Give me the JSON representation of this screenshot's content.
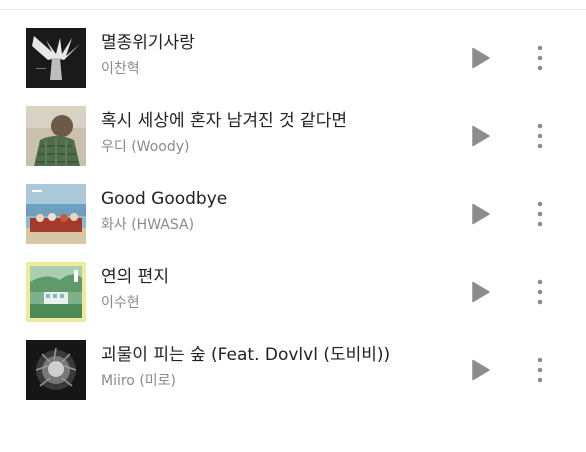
{
  "tracks": [
    {
      "title": "멸종위기사랑",
      "artist": "이찬혁"
    },
    {
      "title": "혹시 세상에 혼자 남겨진 것 같다면",
      "artist": "우디 (Woody)"
    },
    {
      "title": "Good Goodbye",
      "artist": "화사 (HWASA)"
    },
    {
      "title": "연의 편지",
      "artist": "이수현"
    },
    {
      "title": "괴물이 피는 숲 (Feat. Dovlvl (도비비))",
      "artist": "Miiro (미로)"
    }
  ],
  "icons": {
    "play": "play-icon",
    "more": "more-vertical-icon"
  },
  "colors": {
    "title": "#222222",
    "artist": "#8a8a8a",
    "icon": "#8c8c8c"
  }
}
